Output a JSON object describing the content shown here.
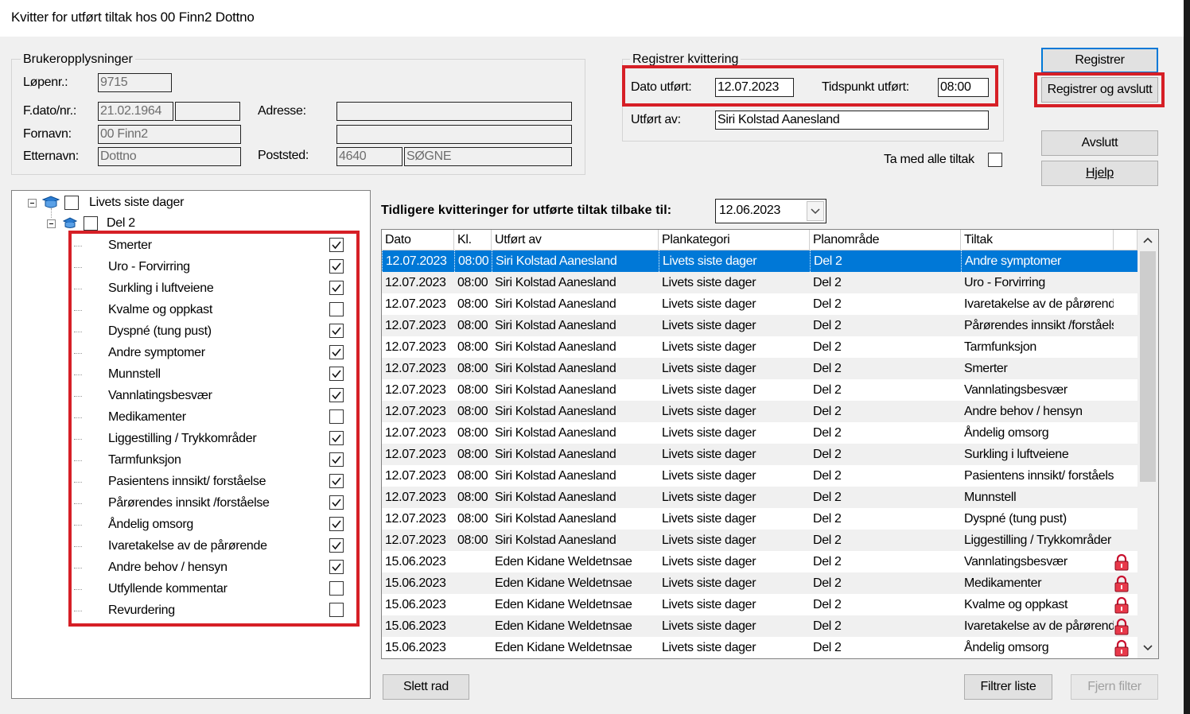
{
  "window": {
    "title": "Kvitter for utført tiltak hos 00 Finn2 Dottno"
  },
  "bruker": {
    "group_label": "Brukeropplysninger",
    "lopenr_label": "Løpenr.:",
    "lopenr": "9715",
    "fdato_label": "F.dato/nr.:",
    "fdato": "21.02.1964",
    "fnr": "",
    "fornavn_label": "Fornavn:",
    "fornavn": "00 Finn2",
    "etternavn_label": "Etternavn:",
    "etternavn": "Dottno",
    "adresse_label": "Adresse:",
    "adresse1": "",
    "adresse2": "",
    "poststed_label": "Poststed:",
    "postnr": "4640",
    "poststed": "SØGNE"
  },
  "registrer": {
    "group_label": "Registrer kvittering",
    "dato_label": "Dato utført:",
    "dato": "12.07.2023",
    "tid_label": "Tidspunkt utført:",
    "tid": "08:00",
    "utfort_label": "Utført av:",
    "utfort": "Siri Kolstad Aanesland",
    "ta_med_label": "Ta med alle tiltak"
  },
  "buttons": {
    "registrer": "Registrer",
    "registrer_avslutt": "Registrer og avslutt",
    "avslutt": "Avslutt",
    "hjelp": "Hjelp",
    "slett_rad": "Slett rad",
    "filtrer": "Filtrer liste",
    "fjern_filter": "Fjern filter"
  },
  "tree": {
    "root": "Livets siste dager",
    "child": "Del 2",
    "items": [
      {
        "label": "Smerter",
        "checked": true
      },
      {
        "label": "Uro - Forvirring",
        "checked": true
      },
      {
        "label": "Surkling i luftveiene",
        "checked": true
      },
      {
        "label": "Kvalme og oppkast",
        "checked": false
      },
      {
        "label": "Dyspné (tung pust)",
        "checked": true
      },
      {
        "label": "Andre symptomer",
        "checked": true
      },
      {
        "label": "Munnstell",
        "checked": true
      },
      {
        "label": "Vannlatingsbesvær",
        "checked": true
      },
      {
        "label": "Medikamenter",
        "checked": false
      },
      {
        "label": "Liggestilling / Trykkområder",
        "checked": true
      },
      {
        "label": "Tarmfunksjon",
        "checked": true
      },
      {
        "label": "Pasientens innsikt/ forståelse",
        "checked": true
      },
      {
        "label": "Pårørendes innsikt /forståelse",
        "checked": true
      },
      {
        "label": "Åndelig omsorg",
        "checked": true
      },
      {
        "label": "Ivaretakelse av de pårørende",
        "checked": true
      },
      {
        "label": "Andre behov / hensyn",
        "checked": true
      },
      {
        "label": "Utfyllende kommentar",
        "checked": false
      },
      {
        "label": "Revurdering",
        "checked": false
      }
    ]
  },
  "history": {
    "label": "Tidligere kvitteringer for utførte tiltak tilbake til:",
    "since": "12.06.2023",
    "columns": [
      "Dato",
      "Kl.",
      "Utført av",
      "Plankategori",
      "Planområde",
      "Tiltak"
    ],
    "rows": [
      [
        "12.07.2023",
        "08:00",
        "Siri Kolstad Aanesland",
        "Livets siste dager",
        "Del 2",
        "Andre symptomer"
      ],
      [
        "12.07.2023",
        "08:00",
        "Siri Kolstad Aanesland",
        "Livets siste dager",
        "Del 2",
        "Uro - Forvirring"
      ],
      [
        "12.07.2023",
        "08:00",
        "Siri Kolstad Aanesland",
        "Livets siste dager",
        "Del 2",
        "Ivaretakelse av de pårørende"
      ],
      [
        "12.07.2023",
        "08:00",
        "Siri Kolstad Aanesland",
        "Livets siste dager",
        "Del 2",
        "Pårørendes innsikt /forståelse"
      ],
      [
        "12.07.2023",
        "08:00",
        "Siri Kolstad Aanesland",
        "Livets siste dager",
        "Del 2",
        "Tarmfunksjon"
      ],
      [
        "12.07.2023",
        "08:00",
        "Siri Kolstad Aanesland",
        "Livets siste dager",
        "Del 2",
        "Smerter"
      ],
      [
        "12.07.2023",
        "08:00",
        "Siri Kolstad Aanesland",
        "Livets siste dager",
        "Del 2",
        "Vannlatingsbesvær"
      ],
      [
        "12.07.2023",
        "08:00",
        "Siri Kolstad Aanesland",
        "Livets siste dager",
        "Del 2",
        "Andre behov / hensyn"
      ],
      [
        "12.07.2023",
        "08:00",
        "Siri Kolstad Aanesland",
        "Livets siste dager",
        "Del 2",
        "Åndelig omsorg"
      ],
      [
        "12.07.2023",
        "08:00",
        "Siri Kolstad Aanesland",
        "Livets siste dager",
        "Del 2",
        "Surkling i luftveiene"
      ],
      [
        "12.07.2023",
        "08:00",
        "Siri Kolstad Aanesland",
        "Livets siste dager",
        "Del 2",
        "Pasientens innsikt/ forståelse"
      ],
      [
        "12.07.2023",
        "08:00",
        "Siri Kolstad Aanesland",
        "Livets siste dager",
        "Del 2",
        "Munnstell"
      ],
      [
        "12.07.2023",
        "08:00",
        "Siri Kolstad Aanesland",
        "Livets siste dager",
        "Del 2",
        "Dyspné (tung pust)"
      ],
      [
        "12.07.2023",
        "08:00",
        "Siri Kolstad Aanesland",
        "Livets siste dager",
        "Del 2",
        "Liggestilling / Trykkområder"
      ],
      [
        "15.06.2023",
        "",
        "Eden Kidane Weldetnsae",
        "Livets siste dager",
        "Del 2",
        "Vannlatingsbesvær"
      ],
      [
        "15.06.2023",
        "",
        "Eden Kidane Weldetnsae",
        "Livets siste dager",
        "Del 2",
        "Medikamenter"
      ],
      [
        "15.06.2023",
        "",
        "Eden Kidane Weldetnsae",
        "Livets siste dager",
        "Del 2",
        "Kvalme og oppkast"
      ],
      [
        "15.06.2023",
        "",
        "Eden Kidane Weldetnsae",
        "Livets siste dager",
        "Del 2",
        "Ivaretakelse av de pårørende"
      ],
      [
        "15.06.2023",
        "",
        "Eden Kidane Weldetnsae",
        "Livets siste dager",
        "Del 2",
        "Åndelig omsorg"
      ]
    ],
    "locked_rows": [
      14,
      15,
      16,
      17,
      18
    ],
    "selected_row": 0
  },
  "colors": {
    "highlight": "#d61f26",
    "selection": "#0078d7"
  }
}
